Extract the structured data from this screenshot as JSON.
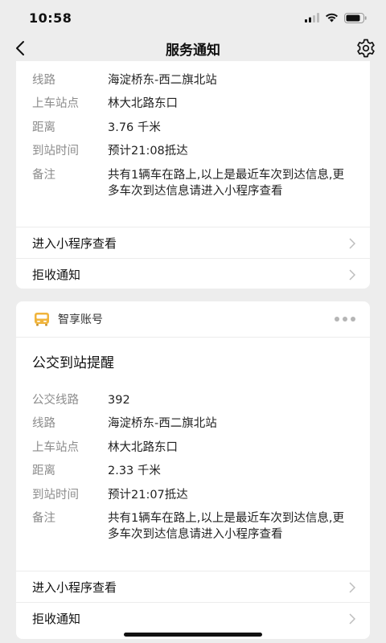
{
  "status": {
    "time": "10:58"
  },
  "nav": {
    "title": "服务通知"
  },
  "card1": {
    "rows": [
      {
        "label": "线路",
        "value": "海淀桥东-西二旗北站"
      },
      {
        "label": "上车站点",
        "value": "林大北路东口"
      },
      {
        "label": "距离",
        "value": "3.76 千米"
      },
      {
        "label": "到站时间",
        "value": "预计21:08抵达"
      },
      {
        "label": "备注",
        "value": "共有1辆车在路上,以上是最近车次到达信息,更多车次到达信息请进入小程序查看"
      }
    ],
    "actions": {
      "open": "进入小程序查看",
      "reject": "拒收通知"
    }
  },
  "card2": {
    "account": "智享账号",
    "title": "公交到站提醒",
    "rows": [
      {
        "label": "公交线路",
        "value": "392"
      },
      {
        "label": "线路",
        "value": "海淀桥东-西二旗北站"
      },
      {
        "label": "上车站点",
        "value": "林大北路东口"
      },
      {
        "label": "距离",
        "value": "2.33 千米"
      },
      {
        "label": "到站时间",
        "value": "预计21:07抵达"
      },
      {
        "label": "备注",
        "value": "共有1辆车在路上,以上是最近车次到达信息,更多车次到达信息请进入小程序查看"
      }
    ],
    "actions": {
      "open": "进入小程序查看",
      "reject": "拒收通知"
    }
  },
  "icons": {
    "back": "chevron-left-icon",
    "settings": "gear-icon",
    "more": "more-dots-icon",
    "account": "bus-icon"
  },
  "colors": {
    "background": "#ededed",
    "card": "#ffffff",
    "label": "#8c8c8c",
    "account_icon": "#f0b43c"
  }
}
